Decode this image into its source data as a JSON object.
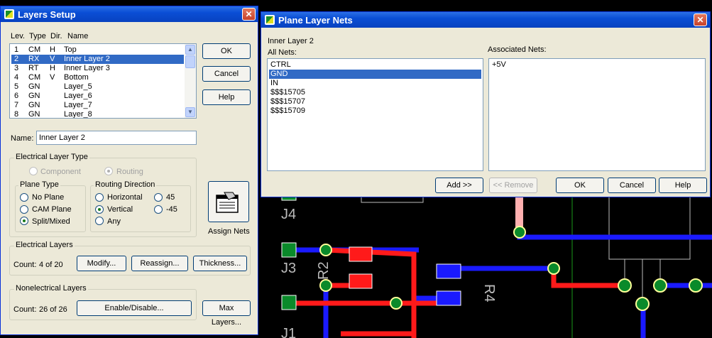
{
  "pcb": {
    "refs": [
      "J4",
      "J3",
      "R2",
      "J1",
      "R4"
    ],
    "colors": {
      "red": "#ff1a1a",
      "blue": "#1a1aff",
      "pad_green": "#0a8a2a",
      "gray": "#bbbbbb",
      "pink": "#ffb0b0"
    }
  },
  "layers_setup": {
    "title": "Layers Setup",
    "close": "✕",
    "columns": {
      "lev": "Lev.",
      "type": "Type",
      "dir": "Dir.",
      "name": "Name"
    },
    "layers": [
      {
        "lev": "1",
        "type": "CM",
        "dir": "H",
        "name": "Top"
      },
      {
        "lev": "2",
        "type": "RX",
        "dir": "V",
        "name": "Inner Layer 2"
      },
      {
        "lev": "3",
        "type": "RT",
        "dir": "H",
        "name": "Inner Layer 3"
      },
      {
        "lev": "4",
        "type": "CM",
        "dir": "V",
        "name": "Bottom"
      },
      {
        "lev": "5",
        "type": "GN",
        "dir": "",
        "name": "Layer_5"
      },
      {
        "lev": "6",
        "type": "GN",
        "dir": "",
        "name": "Layer_6"
      },
      {
        "lev": "7",
        "type": "GN",
        "dir": "",
        "name": "Layer_7"
      },
      {
        "lev": "8",
        "type": "GN",
        "dir": "",
        "name": "Layer_8"
      }
    ],
    "ok": "OK",
    "cancel": "Cancel",
    "help": "Help",
    "name_label": "Name:",
    "name_value": "Inner Layer 2",
    "electrical_layer_type": "Electrical Layer Type",
    "component": "Component",
    "routing": "Routing",
    "plane_type": "Plane Type",
    "no_plane": "No Plane",
    "cam_plane": "CAM Plane",
    "split_mixed": "Split/Mixed",
    "routing_direction": "Routing Direction",
    "horizontal": "Horizontal",
    "vertical": "Vertical",
    "any": "Any",
    "deg45": "45",
    "degm45": "-45",
    "assign_nets": "Assign Nets",
    "electrical_layers": "Electrical Layers",
    "count_label": "Count:",
    "elec_count": "4 of 20",
    "modify": "Modify...",
    "reassign": "Reassign...",
    "thickness": "Thickness...",
    "nonelectrical_layers": "Nonelectrical Layers",
    "nonelec_count": "26 of 26",
    "enable_disable": "Enable/Disable...",
    "max_layers": "Max Layers..."
  },
  "plane_nets": {
    "title": "Plane Layer Nets",
    "close": "✕",
    "layer_name": "Inner Layer 2",
    "all_nets_label": "All Nets:",
    "all_nets": [
      "CTRL",
      "GND",
      "IN",
      "$$$15705",
      "$$$15707",
      "$$$15709"
    ],
    "selected_net": "GND",
    "associated_label": "Associated Nets:",
    "associated_nets": [
      "+5V"
    ],
    "add": "Add >>",
    "remove": "<< Remove",
    "ok": "OK",
    "cancel": "Cancel",
    "help": "Help"
  }
}
